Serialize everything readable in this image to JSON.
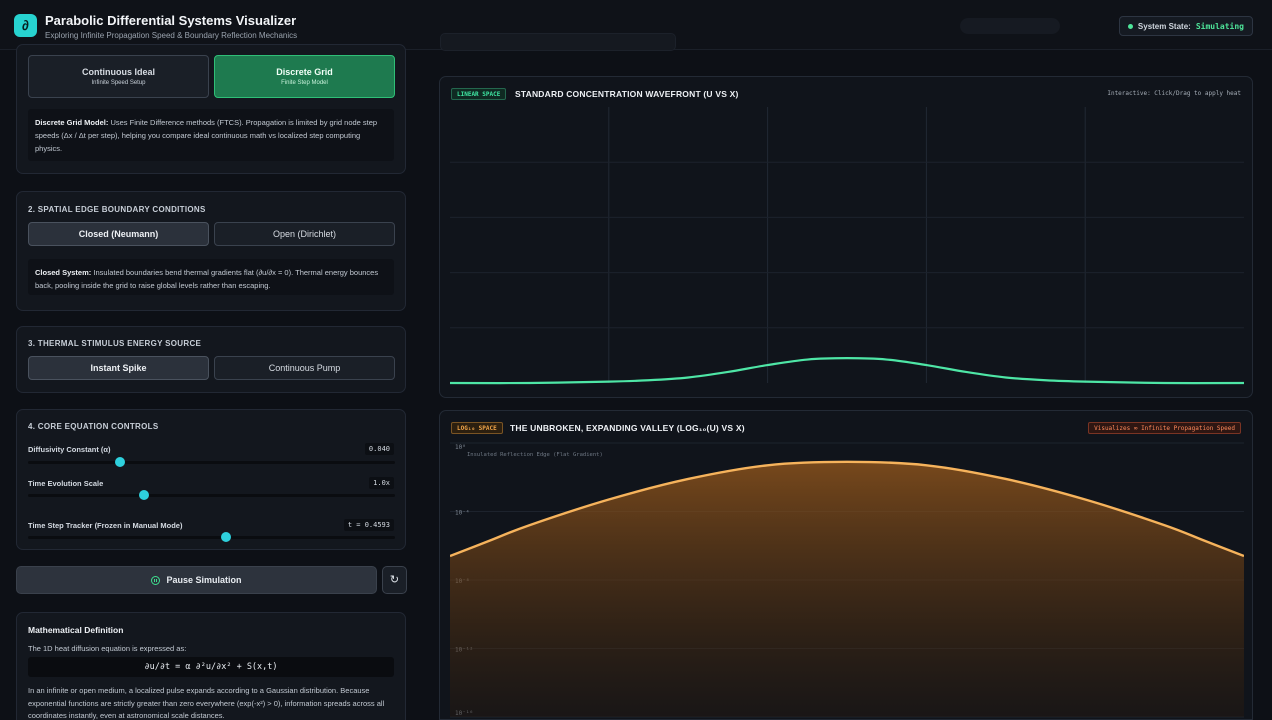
{
  "header": {
    "logo_glyph": "∂",
    "title": "Parabolic Differential Systems Visualizer",
    "subtitle": "Exploring Infinite Propagation Speed & Boundary Reflection Mechanics",
    "status_label": "System State:",
    "status_value": "Simulating"
  },
  "model_section": {
    "options": [
      {
        "label": "Continuous Ideal",
        "sub": "Infinite Speed Setup",
        "selected": false
      },
      {
        "label": "Discrete Grid",
        "sub": "Finite Step Model",
        "selected": true
      }
    ],
    "info_bold": "Discrete Grid Model:",
    "info_text": " Uses Finite Difference methods (FTCS). Propagation is limited by grid node step speeds (Δx / Δt per step), helping you compare ideal continuous math vs localized step computing physics."
  },
  "boundary_section": {
    "title": "2. SPATIAL EDGE BOUNDARY CONDITIONS",
    "options": [
      {
        "label": "Closed (Neumann)",
        "selected": true
      },
      {
        "label": "Open (Dirichlet)",
        "selected": false
      }
    ],
    "info_bold": "Closed System:",
    "info_text": " Insulated boundaries bend thermal gradients flat (∂u/∂x = 0). Thermal energy bounces back, pooling inside the grid to raise global levels rather than escaping."
  },
  "source_section": {
    "title": "3. THERMAL STIMULUS ENERGY SOURCE",
    "options": [
      {
        "label": "Instant Spike",
        "selected": true
      },
      {
        "label": "Continuous Pump",
        "selected": false
      }
    ]
  },
  "controls_section": {
    "title": "4. CORE EQUATION CONTROLS",
    "sliders": [
      {
        "label": "Diffusivity Constant (α)",
        "value": "0.040",
        "fraction": 0.25
      },
      {
        "label": "Time Evolution Scale",
        "value": "1.0x",
        "fraction": 0.315
      },
      {
        "label": "Time Step Tracker (Frozen in Manual Mode)",
        "value": "t = 0.4593",
        "fraction": 0.54
      }
    ]
  },
  "actions": {
    "pause_label": "Pause Simulation",
    "reset_glyph": "↻"
  },
  "math": {
    "title": "Mathematical Definition",
    "intro": "The 1D heat diffusion equation is expressed as:",
    "equation": "∂u/∂t = α ∂²u/∂x² + S(x,t)",
    "body": "In an infinite or open medium, a localized pulse expands according to a Gaussian distribution. Because exponential functions are strictly greater than zero everywhere (exp(-x²) > 0), information spreads across all coordinates instantly, even at astronomical scale distances."
  },
  "linear_chart": {
    "tag": "LINEAR SPACE",
    "title": "STANDARD CONCENTRATION WAVEFRONT (U VS X)",
    "hint": "Interactive: Click/Drag to apply heat",
    "line_color": "#4ee6a6"
  },
  "log_chart": {
    "tag": "LOG₁₀ SPACE",
    "title": "THE UNBROKEN, EXPANDING VALLEY (LOG₁₀(U) VS X)",
    "badge": "Visualizes ∞ Infinite Propagation Speed",
    "annotation": "Insulated Reflection Edge (Flat Gradient)",
    "y_ticks": [
      "10⁰",
      "10⁻⁴",
      "10⁻⁸",
      "10⁻¹²",
      "10⁻¹⁶"
    ],
    "line_color": "#f6b35c"
  },
  "chart_data": [
    {
      "type": "line",
      "title": "STANDARD CONCENTRATION WAVEFRONT (U VS X)",
      "xlabel": "",
      "ylabel": "",
      "grid": true,
      "x": [
        0,
        0.1,
        0.2,
        0.25,
        0.3,
        0.35,
        0.4,
        0.45,
        0.5,
        0.55,
        0.6,
        0.65,
        0.7,
        0.75,
        0.8,
        0.9,
        1
      ],
      "series": [
        {
          "values": [
            0,
            0,
            0.005,
            0.01,
            0.02,
            0.04,
            0.065,
            0.085,
            0.09,
            0.085,
            0.065,
            0.04,
            0.02,
            0.01,
            0.005,
            0,
            0
          ]
        }
      ],
      "ylim": [
        0,
        1
      ]
    },
    {
      "type": "area",
      "title": "THE UNBROKEN, EXPANDING VALLEY (LOG₁₀(U) VS X)",
      "xlabel": "",
      "ylabel": "",
      "y_scale": "log",
      "y_ticks": [
        "10⁰",
        "10⁻⁴",
        "10⁻⁸",
        "10⁻¹²",
        "10⁻¹⁶"
      ],
      "x": [
        0,
        0.05,
        0.1,
        0.2,
        0.3,
        0.4,
        0.5,
        0.6,
        0.7,
        0.8,
        0.9,
        0.95,
        1
      ],
      "series": [
        {
          "values": [
            -6.6,
            -5.7,
            -4.8,
            -3.3,
            -2.1,
            -1.3,
            -1.1,
            -1.3,
            -2.1,
            -3.3,
            -4.8,
            -5.7,
            -6.6
          ]
        }
      ],
      "ylim": [
        -16,
        0
      ]
    }
  ]
}
